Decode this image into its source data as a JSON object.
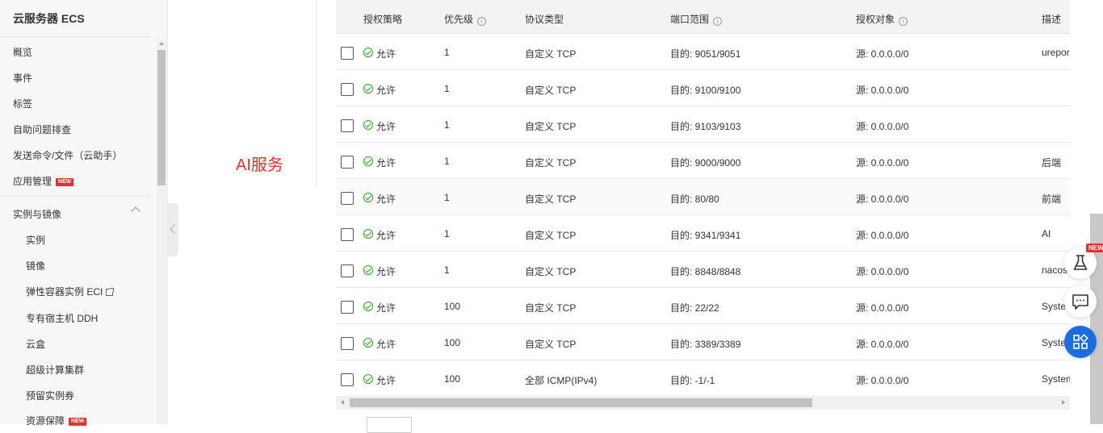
{
  "sidebar": {
    "title": "云服务器 ECS",
    "items": [
      "概览",
      "事件",
      "标签",
      "自助问题排查",
      "发送命令/文件（云助手）",
      "应用管理"
    ],
    "new_badge": "NEW",
    "group_title": "实例与镜像",
    "sub_items": [
      "实例",
      "镜像",
      "弹性容器实例 ECI",
      "专有宿主机 DDH",
      "云盒",
      "超级计算集群",
      "预留实例券",
      "资源保障"
    ]
  },
  "page": {
    "label": "AI服务",
    "label_color": "#e8302f"
  },
  "table": {
    "headers": {
      "policy": "授权策略",
      "priority": "优先级",
      "protocol": "协议类型",
      "port": "端口范围",
      "source": "授权对象",
      "desc": "描述"
    },
    "info_glyph": "i",
    "rows": [
      {
        "policy": "允许",
        "priority": "1",
        "protocol": "自定义 TCP",
        "port": "目的: 9051/9051",
        "source": "源: 0.0.0.0/0",
        "desc": "urepor"
      },
      {
        "policy": "允许",
        "priority": "1",
        "protocol": "自定义 TCP",
        "port": "目的: 9100/9100",
        "source": "源: 0.0.0.0/0",
        "desc": ""
      },
      {
        "policy": "允许",
        "priority": "1",
        "protocol": "自定义 TCP",
        "port": "目的: 9103/9103",
        "source": "源: 0.0.0.0/0",
        "desc": ""
      },
      {
        "policy": "允许",
        "priority": "1",
        "protocol": "自定义 TCP",
        "port": "目的: 9000/9000",
        "source": "源: 0.0.0.0/0",
        "desc": "后端"
      },
      {
        "policy": "允许",
        "priority": "1",
        "protocol": "自定义 TCP",
        "port": "目的: 80/80",
        "source": "源: 0.0.0.0/0",
        "desc": "前端"
      },
      {
        "policy": "允许",
        "priority": "1",
        "protocol": "自定义 TCP",
        "port": "目的: 9341/9341",
        "source": "源: 0.0.0.0/0",
        "desc": "AI"
      },
      {
        "policy": "允许",
        "priority": "1",
        "protocol": "自定义 TCP",
        "port": "目的: 8848/8848",
        "source": "源: 0.0.0.0/0",
        "desc": "nacos"
      },
      {
        "policy": "允许",
        "priority": "100",
        "protocol": "自定义 TCP",
        "port": "目的: 22/22",
        "source": "源: 0.0.0.0/0",
        "desc": "Syster"
      },
      {
        "policy": "允许",
        "priority": "100",
        "protocol": "自定义 TCP",
        "port": "目的: 3389/3389",
        "source": "源: 0.0.0.0/0",
        "desc": "Syster"
      },
      {
        "policy": "允许",
        "priority": "100",
        "protocol": "全部 ICMP(IPv4)",
        "port": "目的: -1/-1",
        "source": "源: 0.0.0.0/0",
        "desc": "System"
      }
    ]
  },
  "float_buttons": {
    "new_badge": "NEW",
    "icons": [
      "lab-flask-icon",
      "chat-icon",
      "apps-grid-icon"
    ]
  },
  "colors": {
    "accent": "#1b6ce0",
    "allow_green": "#2ea121",
    "badge_red": "#e8302f"
  }
}
